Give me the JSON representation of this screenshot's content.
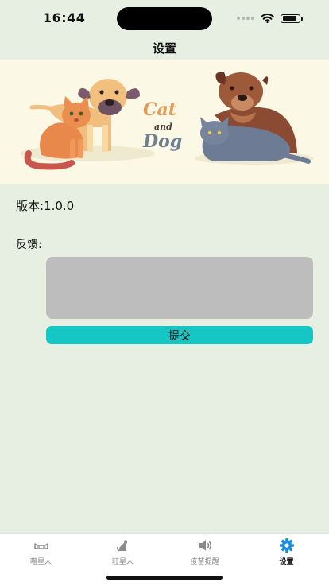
{
  "status_bar": {
    "time": "16:44"
  },
  "nav": {
    "title": "设置"
  },
  "banner": {
    "text_cat": "Cat",
    "text_and": "and",
    "text_dog": "Dog"
  },
  "settings": {
    "version_text": "版本:1.0.0",
    "feedback_label": "反馈:",
    "feedback_value": "",
    "submit_label": "提交"
  },
  "tabs": [
    {
      "label": "喵星人",
      "icon": "cat-sleeping-icon",
      "active": false
    },
    {
      "label": "旺星人",
      "icon": "dog-sitting-icon",
      "active": false
    },
    {
      "label": "疫苗提醒",
      "icon": "speaker-icon",
      "active": false
    },
    {
      "label": "设置",
      "icon": "gear-icon",
      "active": true
    }
  ],
  "colors": {
    "background": "#e7eee2",
    "accent": "#16c6c4",
    "active_tab": "#1a8fe0",
    "input": "#bdbdbd"
  }
}
